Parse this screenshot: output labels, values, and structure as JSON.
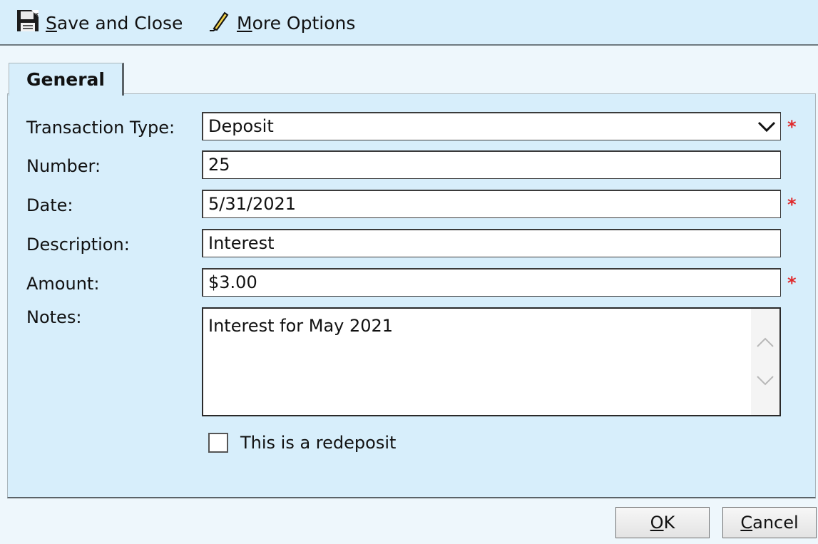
{
  "toolbar": {
    "save_close": {
      "mnemonic": "S",
      "rest": "ave and Close",
      "icon": "floppy-disk-icon"
    },
    "more_options": {
      "mnemonic": "M",
      "rest": "ore Options",
      "icon": "pencil-icon"
    }
  },
  "tabs": [
    {
      "label": "General",
      "selected": true
    }
  ],
  "form": {
    "transaction_type": {
      "label": "Transaction Type:",
      "value": "Deposit",
      "required": true
    },
    "number": {
      "label": "Number:",
      "value": "25",
      "required": false
    },
    "date": {
      "label": "Date:",
      "value": "5/31/2021",
      "required": true
    },
    "description": {
      "label": "Description:",
      "value": "Interest",
      "required": false
    },
    "amount": {
      "label": "Amount:",
      "value": "$3.00",
      "required": true
    },
    "notes": {
      "label": "Notes:",
      "value": "Interest for May 2021"
    },
    "redeposit": {
      "label": "This is a redeposit",
      "checked": false
    },
    "required_marker": "*"
  },
  "buttons": {
    "ok": {
      "mnemonic": "O",
      "rest": "K"
    },
    "cancel": {
      "mnemonic": "C",
      "rest": "ancel"
    }
  },
  "colors": {
    "panel_background": "#d7eefb",
    "required_asterisk": "#e0282a"
  }
}
